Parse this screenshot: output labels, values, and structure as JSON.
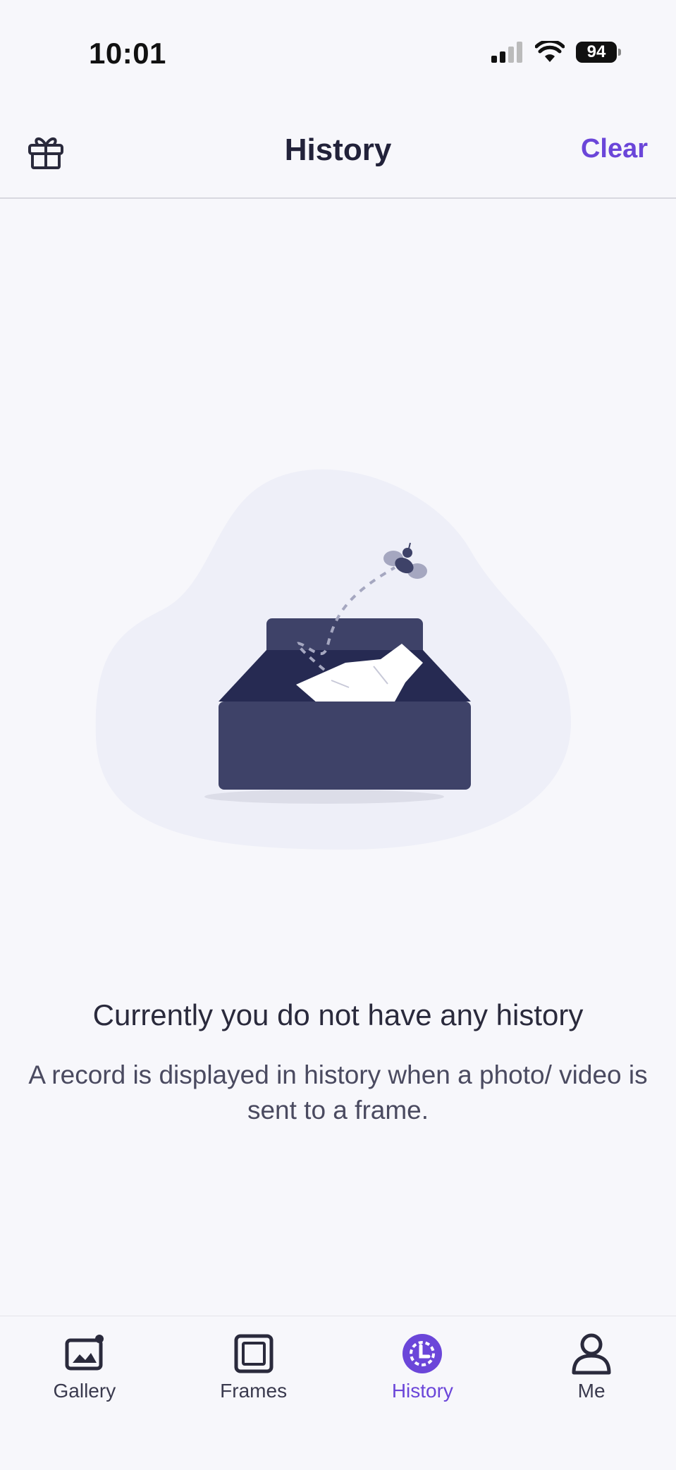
{
  "status_bar": {
    "time": "10:01",
    "battery": "94",
    "icons": [
      "signal-icon",
      "wifi-icon",
      "battery-icon"
    ]
  },
  "header": {
    "title": "History",
    "clear_label": "Clear",
    "left_icon": "gift-icon"
  },
  "empty_state": {
    "illustration": "empty-box-with-bee",
    "title": "Currently you do not have any history",
    "description": "A record is displayed in history when a photo/ video is sent to a frame."
  },
  "tabs": [
    {
      "label": "Gallery",
      "icon": "gallery-icon",
      "active": false
    },
    {
      "label": "Frames",
      "icon": "frames-icon",
      "active": false
    },
    {
      "label": "History",
      "icon": "history-icon",
      "active": true
    },
    {
      "label": "Me",
      "icon": "profile-icon",
      "active": false
    }
  ],
  "colors": {
    "accent": "#6b46d9",
    "background": "#f7f7fb",
    "box": "#3e4268"
  }
}
